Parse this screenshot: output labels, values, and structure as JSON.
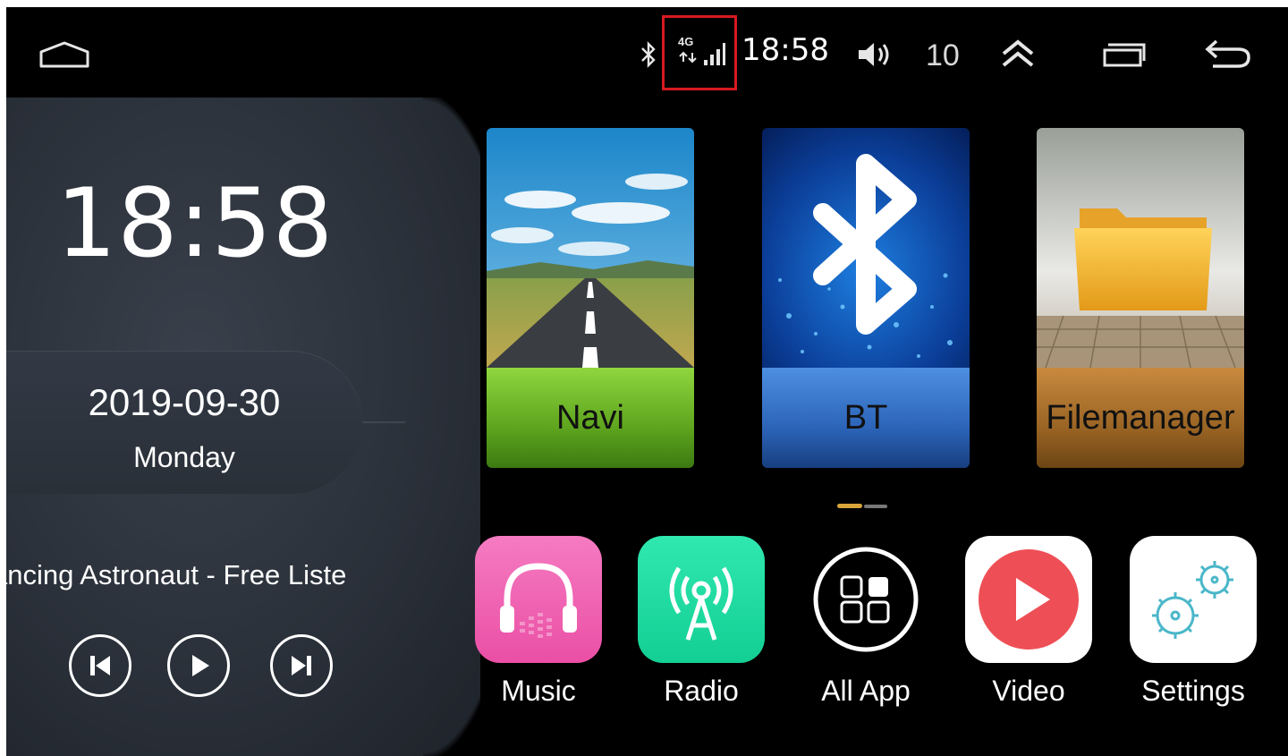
{
  "status_bar": {
    "time": "18:58",
    "network_label": "4G",
    "signal_bars": 3,
    "volume_level": "10",
    "highlight_color": "#d71920",
    "icons": [
      "home-icon",
      "bluetooth-icon",
      "signal-icon",
      "volume-icon",
      "chevron-up-icon",
      "recent-apps-icon",
      "back-icon"
    ]
  },
  "left_panel": {
    "clock": "18:58",
    "date": "2019-09-30",
    "day": "Monday",
    "now_playing": "ancing Astronaut - Free Liste",
    "controls": [
      "previous-icon",
      "play-icon",
      "next-icon"
    ]
  },
  "tiles": [
    {
      "label": "Navi",
      "icon": "road-landscape-icon",
      "color": "#6cb52a"
    },
    {
      "label": "BT",
      "icon": "bluetooth-icon",
      "color": "#2f6fc4"
    },
    {
      "label": "Filemanager",
      "icon": "folder-icon",
      "color": "#a36a28"
    }
  ],
  "pager": {
    "pages": 2,
    "current": 1
  },
  "apps": [
    {
      "label": "Music",
      "icon": "headphones-icon",
      "color": "#ee5fb0"
    },
    {
      "label": "Radio",
      "icon": "antenna-icon",
      "color": "#1bd89d"
    },
    {
      "label": "All App",
      "icon": "grid-icon",
      "color": "#ffffff"
    },
    {
      "label": "Video",
      "icon": "play-icon",
      "color": "#ee4f56"
    },
    {
      "label": "Settings",
      "icon": "gears-icon",
      "color": "#4ab7c9"
    }
  ]
}
